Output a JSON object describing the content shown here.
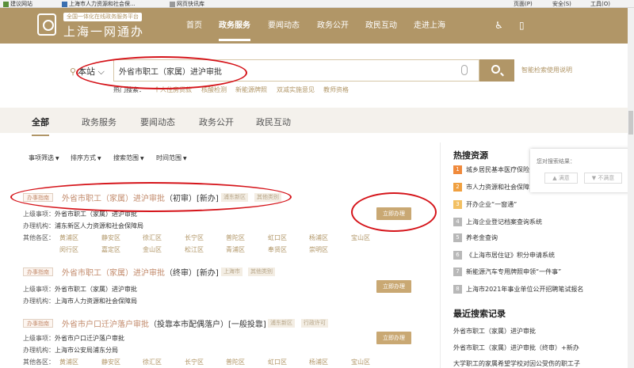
{
  "browser": {
    "favorites": "建议网站",
    "tab1": "上海市人力资源和社会保...",
    "tab2": "网页快讯库",
    "tools": [
      "页面(P)",
      "安全(S)",
      "工具(O)"
    ]
  },
  "header": {
    "badge": "全国一体化在线政务服务平台",
    "title": "上海一网通办",
    "nav": [
      "首页",
      "政务服务",
      "要闻动态",
      "政务公开",
      "政民互动",
      "走进上海"
    ],
    "active_nav": "政务服务",
    "icons": [
      "accessibility-icon",
      "mobile-icon"
    ]
  },
  "search": {
    "scope": "本站",
    "query": "外省市职工（家属）进沪审批",
    "smart_link": "智能检索使用说明",
    "hot_label": "热门搜索：",
    "hot_items": [
      "个人住房贷款",
      "核酸检测",
      "新能源牌照",
      "双减实施意见",
      "教师资格"
    ]
  },
  "tabs": [
    "全部",
    "政务服务",
    "要闻动态",
    "政务公开",
    "政民互动"
  ],
  "filters": [
    "事项筛选",
    "排序方式",
    "搜索范围",
    "时间范围"
  ],
  "results": [
    {
      "tag": "办事指南",
      "title_pre": "外省市职工（家属）进沪审批",
      "title_post": "（初审）[新办]",
      "regions": [
        "浦东新区",
        "其他类别"
      ],
      "superior_label": "上级事项：",
      "superior": "外省市职工（家属）进沪审批",
      "agency_label": "办理机构：",
      "agency": "浦东新区人力资源和社会保障局",
      "other_label": "其他各区：",
      "districts": [
        "黄浦区",
        "静安区",
        "徐汇区",
        "长宁区",
        "普陀区",
        "虹口区",
        "杨浦区",
        "宝山区",
        "闵行区",
        "嘉定区",
        "金山区",
        "松江区",
        "青浦区",
        "奉贤区",
        "崇明区"
      ],
      "apply": "立即办理"
    },
    {
      "tag": "办事指南",
      "title_pre": "外省市职工（家属）进沪审批",
      "title_post": "（终审）[新办]",
      "regions": [
        "上海市",
        "其他类别"
      ],
      "superior_label": "上级事项：",
      "superior": "外省市职工（家属）进沪审批",
      "agency_label": "办理机构：",
      "agency": "上海市人力资源和社会保障局",
      "apply": "立即办理"
    },
    {
      "tag": "办事指南",
      "title_pre": "外省市户口迁沪落户审批",
      "title_post": "（投靠本市配偶落户）[一般投靠]",
      "regions": [
        "浦东新区",
        "行政许可"
      ],
      "superior_label": "上级事项：",
      "superior": "外省市户口迁沪落户审批",
      "agency_label": "办理机构：",
      "agency": "上海市公安局浦东分局",
      "other_label": "其他各区：",
      "districts": [
        "黄浦区",
        "静安区",
        "徐汇区",
        "长宁区",
        "普陀区",
        "虹口区",
        "杨浦区",
        "宝山区"
      ],
      "apply": "立即办理"
    }
  ],
  "hot_resources": {
    "title": "热搜资源",
    "items": [
      "城乡居民基本医疗保险",
      "市人力资源和社会保障",
      "开办企业“一窗通”",
      "上海企业登记档案查询系统",
      "养老金查询",
      "《上海市居住证》积分申请系统",
      "新能源汽车专用牌照申领“一件事”",
      "上海市2021年事业单位公开招聘笔试报名"
    ],
    "rank_colors": [
      "#f08a3c",
      "#f0a040",
      "#f2c063",
      "#b8b8b8"
    ]
  },
  "recent": {
    "title": "最近搜索记录",
    "items": [
      "外省市职工（家属）进沪审批",
      "外省市职工（家属）进沪审批（终审）+新办",
      "大学职工的家属希望学校对因公受伤的职工子"
    ]
  },
  "feedback": {
    "question": "您对搜索结果：",
    "yes": "满意",
    "no": "不满意"
  }
}
